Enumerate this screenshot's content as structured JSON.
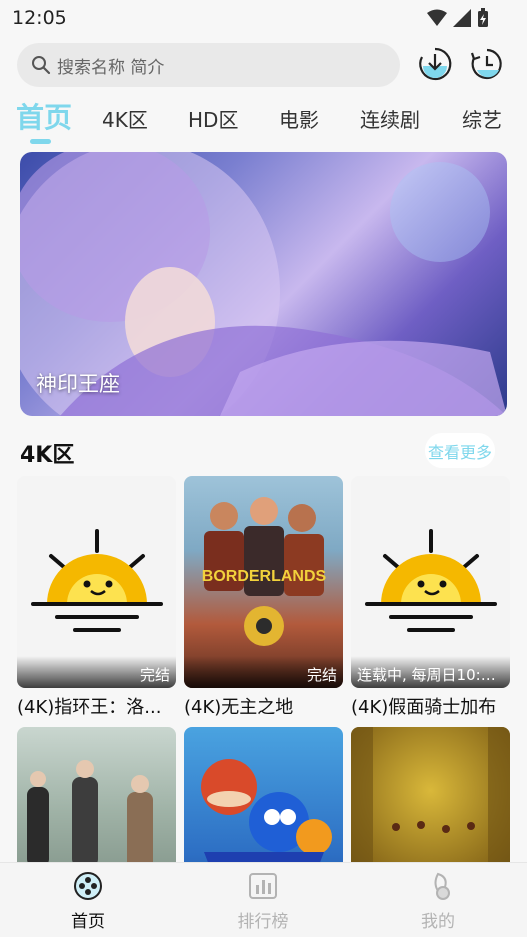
{
  "status": {
    "time": "12:05"
  },
  "search": {
    "placeholder": "搜索名称 简介"
  },
  "header_icons": [
    "download-icon",
    "history-icon"
  ],
  "tabs": [
    {
      "label": "首页",
      "active": true
    },
    {
      "label": "4K区"
    },
    {
      "label": "HD区"
    },
    {
      "label": "电影"
    },
    {
      "label": "连续剧"
    },
    {
      "label": "综艺"
    }
  ],
  "banner": {
    "title": "神印王座"
  },
  "section": {
    "title": "4K区",
    "more_label": "查看更多"
  },
  "cards": [
    {
      "title": "(4K)指环王：洛...",
      "badge": "完结"
    },
    {
      "title": "(4K)无主之地",
      "badge": "完结"
    },
    {
      "title": "(4K)假面骑士加布",
      "badge": "连载中, 每周日10:0..."
    }
  ],
  "bottom_nav": [
    {
      "label": "首页",
      "active": true
    },
    {
      "label": "排行榜"
    },
    {
      "label": "我的"
    }
  ],
  "colors": {
    "accent": "#7fd7ec",
    "inactive": "#b3b3b3"
  }
}
